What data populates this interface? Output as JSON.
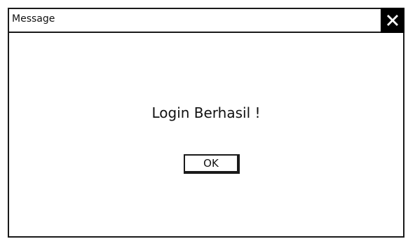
{
  "window": {
    "title": "Message",
    "close_icon": "close-icon"
  },
  "dialog": {
    "message": "Login Berhasil !",
    "ok_label": "OK"
  }
}
